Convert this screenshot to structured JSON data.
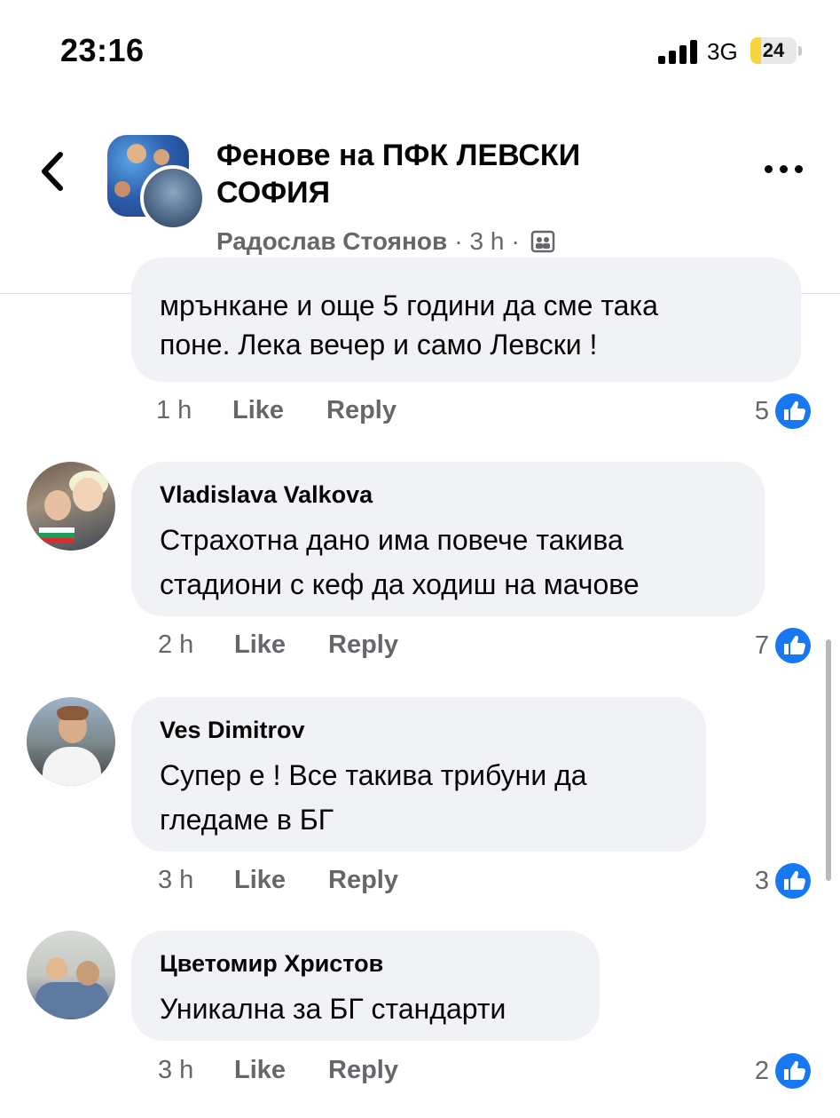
{
  "status_bar": {
    "time": "23:16",
    "network": "3G",
    "battery": "24",
    "battery_fraction": 0.24
  },
  "header": {
    "back_icon": "chevron-left-icon",
    "group_name": "Фенове на ПФК ЛЕВСКИ СОФИЯ",
    "author": "Радослав Стоянов",
    "separator": "·",
    "time": "3 h",
    "privacy_icon": "group-privacy-icon",
    "more_icon": "more-horizontal-icon"
  },
  "comments": [
    {
      "author": "",
      "lines": [
        "мрънкане и още 5 години да сме така",
        "поне. Лека вечер и само Левски !"
      ],
      "age": "1 h",
      "like_label": "Like",
      "reply_label": "Reply",
      "reactions": "5"
    },
    {
      "author": "Vladislava Valkova",
      "lines": [
        "Страхотна дано има повече такива",
        "стадиони с кеф да ходиш на мачове"
      ],
      "age": "2 h",
      "like_label": "Like",
      "reply_label": "Reply",
      "reactions": "7"
    },
    {
      "author": "Ves Dimitrov",
      "lines": [
        "Супер е ! Все такива трибуни да",
        "гледаме в БГ"
      ],
      "age": "3 h",
      "like_label": "Like",
      "reply_label": "Reply",
      "reactions": "3"
    },
    {
      "author": "Цветомир Христов",
      "lines": [
        "Уникална за БГ стандарти"
      ],
      "age": "3 h",
      "like_label": "Like",
      "reply_label": "Reply",
      "reactions": "2"
    }
  ],
  "colors": {
    "bubble": "#f0f2f5",
    "meta_text": "#65676b",
    "like_blue": "#1877f2"
  }
}
